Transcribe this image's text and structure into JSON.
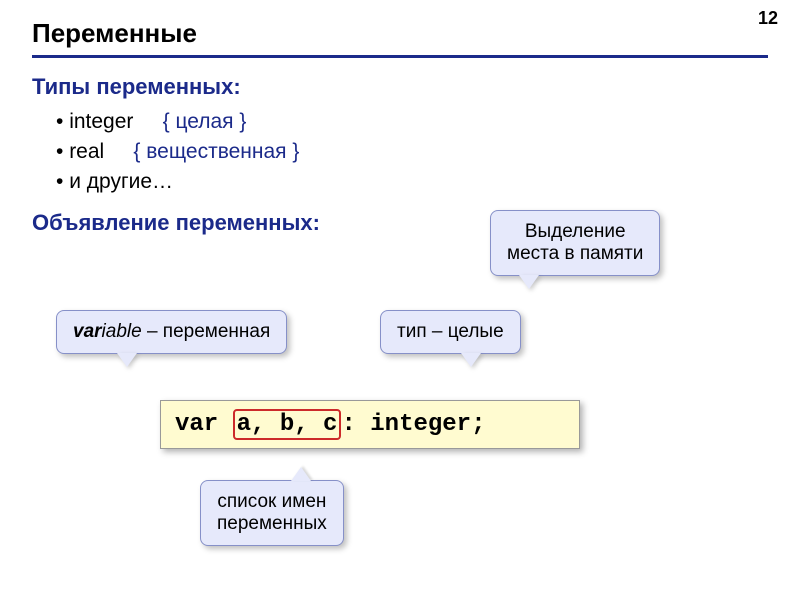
{
  "page_number": "12",
  "title": "Переменные",
  "sections": {
    "types": {
      "heading": "Типы переменных:",
      "items": [
        {
          "name": "integer",
          "comment": "{ целая }"
        },
        {
          "name": "real",
          "comment": "{ вещественная }"
        },
        {
          "name": "и другие…",
          "comment": ""
        }
      ]
    },
    "decl_heading": "Объявление переменных:"
  },
  "callouts": {
    "variable_prefix": "var",
    "variable_suffix": "iable",
    "variable_rest": " – переменная",
    "type_label": "тип – целые",
    "memory_line1": "Выделение",
    "memory_line2": "места в памяти",
    "list_line1": "список имен",
    "list_line2": "переменных"
  },
  "code": {
    "kw": "var",
    "names": "a, b, c",
    "suffix": ": integer;"
  }
}
